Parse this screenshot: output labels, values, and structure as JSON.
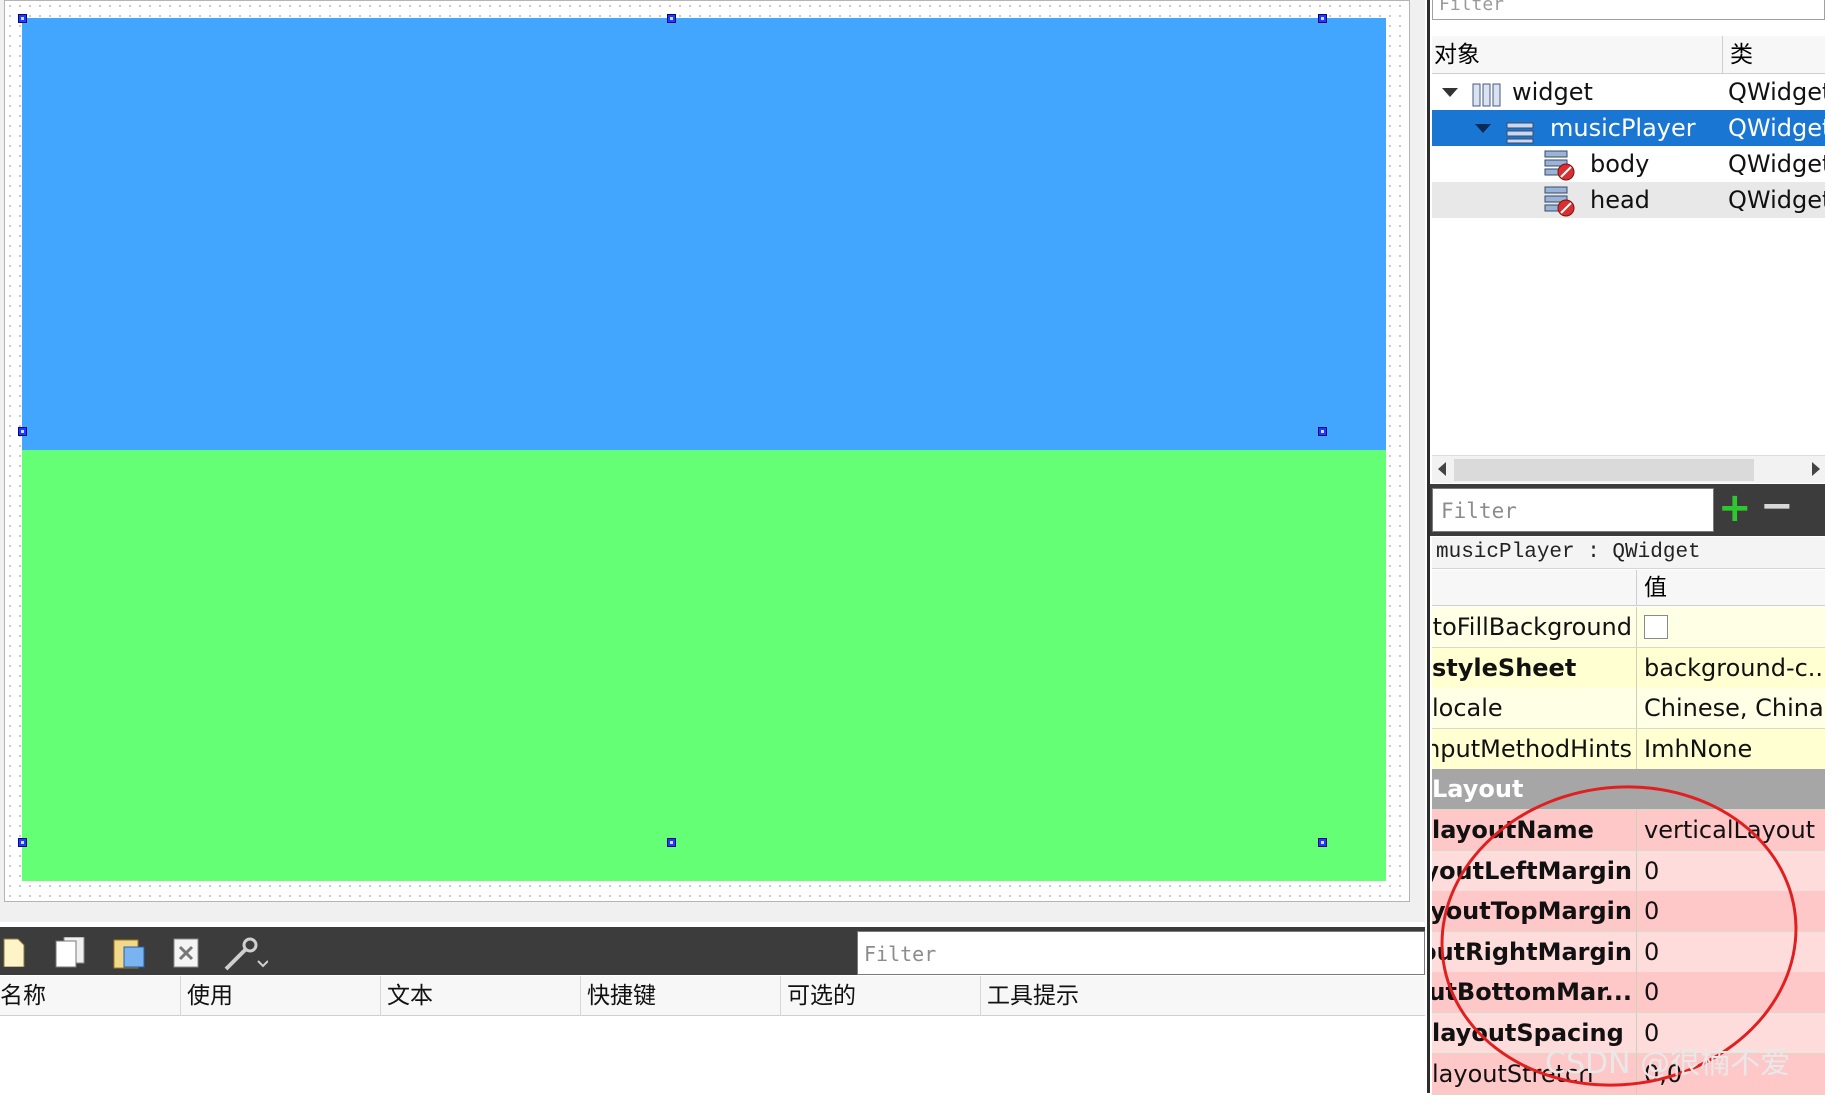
{
  "object_inspector": {
    "filter_placeholder": "Filter",
    "columns": [
      "对象",
      "类"
    ],
    "rows": [
      {
        "name": "widget",
        "class": "QWidget",
        "icon": "horizontal-layout-icon",
        "expanded": true,
        "selected": false
      },
      {
        "name": "musicPlayer",
        "class": "QWidget",
        "icon": "vertical-layout-icon",
        "expanded": true,
        "selected": true
      },
      {
        "name": "body",
        "class": "QWidget",
        "icon": "broken-layout-widget-icon",
        "selected": false
      },
      {
        "name": "head",
        "class": "QWidget",
        "icon": "broken-layout-widget-icon",
        "selected": false
      }
    ]
  },
  "property_editor": {
    "filter_placeholder": "Filter",
    "add_label": "+",
    "remove_label": "−",
    "object_label": "musicPlayer : QWidget",
    "value_header": "值",
    "rows": [
      {
        "name": "autoFillBackground",
        "value": "",
        "checkbox": true,
        "bold": false,
        "bg": "#ffffe6"
      },
      {
        "name": "styleSheet",
        "value": "background-c...",
        "bold": true,
        "bg": "#ffffd2"
      },
      {
        "name": "locale",
        "value": "Chinese, China",
        "bold": false,
        "bg": "#ffffe6"
      },
      {
        "name": "inputMethodHints",
        "value": "ImhNone",
        "bold": false,
        "bg": "#ffffd2"
      },
      {
        "name": "Layout",
        "value": "",
        "section": true,
        "bold": true,
        "bg": "#a6a6a6"
      },
      {
        "name": "layoutName",
        "value": "verticalLayout",
        "bold": true,
        "bg": "#ffc8c8"
      },
      {
        "name": "layoutLeftMargin",
        "value": "0",
        "bold": true,
        "bg": "#ffdcdc"
      },
      {
        "name": "layoutTopMargin",
        "value": "0",
        "bold": true,
        "bg": "#ffc8c8"
      },
      {
        "name": "layoutRightMargin",
        "value": "0",
        "bold": true,
        "bg": "#ffdcdc"
      },
      {
        "name": "layoutBottomMar...",
        "value": "0",
        "bold": true,
        "bg": "#ffc8c8"
      },
      {
        "name": "layoutSpacing",
        "value": "0",
        "bold": true,
        "bg": "#ffdcdc"
      },
      {
        "name": "layoutStretch",
        "value": "0,0",
        "bold": false,
        "bg": "#ffc8c8"
      }
    ]
  },
  "action_editor": {
    "filter_placeholder": "Filter",
    "columns": [
      "名称",
      "使用",
      "文本",
      "快捷键",
      "可选的",
      "工具提示"
    ],
    "toolbar_icons": [
      "new-action-icon",
      "copy-action-icon",
      "paste-action-icon",
      "delete-action-icon",
      "configure-icon"
    ]
  },
  "canvas": {
    "head_color": "#42a6ff",
    "body_color": "#64ff74"
  },
  "watermark": "CSDN @很楠不爱"
}
